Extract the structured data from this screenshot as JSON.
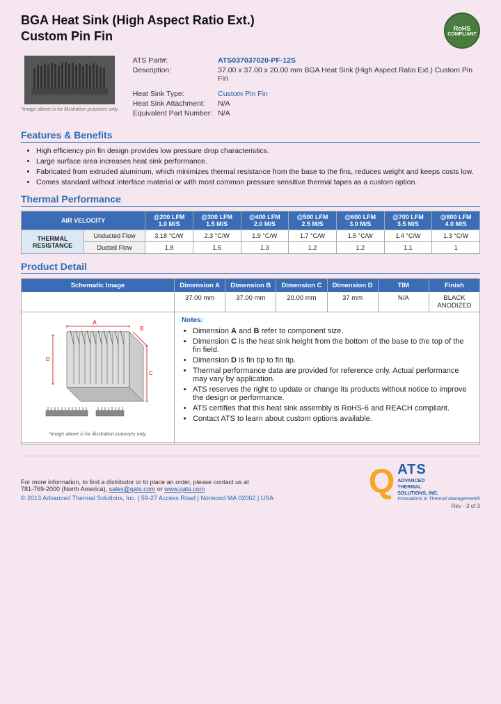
{
  "page": {
    "background": "#f5e6f0"
  },
  "header": {
    "title_line1": "BGA Heat Sink (High Aspect Ratio Ext.)",
    "title_line2": "Custom Pin Fin",
    "rohs": {
      "line1": "RoHS",
      "line2": "COMPLIANT"
    }
  },
  "product": {
    "part_label": "ATS Part#:",
    "part_number": "ATS037037020-PF-12S",
    "description_label": "Description:",
    "description_value": "37.00 x 37.00 x 20.00 mm  BGA Heat Sink (High Aspect Ratio Ext.) Custom Pin Fin",
    "heat_sink_type_label": "Heat Sink Type:",
    "heat_sink_type_value": "Custom Pin Fin",
    "attachment_label": "Heat Sink Attachment:",
    "attachment_value": "N/A",
    "equiv_part_label": "Equivalent Part Number:",
    "equiv_part_value": "N/A"
  },
  "image_caption": "*Image above is for illustration purposes only.",
  "features": {
    "title": "Features & Benefits",
    "items": [
      "High efficiency pin fin design provides low pressure drop characteristics.",
      "Large surface area increases heat sink performance.",
      "Fabricated from extruded aluminum, which minimizes thermal resistance from the base to the fins, reduces weight and keeps costs low.",
      "Comes standard without interface material or with most common pressure sensitive thermal tapes as a custom option."
    ]
  },
  "thermal": {
    "title": "Thermal Performance",
    "col_headers": [
      "AIR VELOCITY",
      "@200 LFM\n1.0 M/S",
      "@300 LFM\n1.5 M/S",
      "@400 LFM\n2.0 M/S",
      "@500 LFM\n2.5 M/S",
      "@600 LFM\n3.0 M/S",
      "@700 LFM\n3.5 M/S",
      "@800 LFM\n4.0 M/S"
    ],
    "row_group": "THERMAL RESISTANCE",
    "rows": [
      {
        "label": "Unducted Flow",
        "values": [
          "3.18 °C/W",
          "2.3 °C/W",
          "1.9 °C/W",
          "1.7 °C/W",
          "1.5 °C/W",
          "1.4 °C/W",
          "1.3 °C/W"
        ]
      },
      {
        "label": "Ducted Flow",
        "values": [
          "1.8",
          "1.5",
          "1.3",
          "1.2",
          "1.2",
          "1.1",
          "1"
        ]
      }
    ]
  },
  "product_detail": {
    "title": "Product Detail",
    "schematic_caption": "*Image above is for illustration purposes only.",
    "columns": [
      "Schematic Image",
      "Dimension A",
      "Dimension B",
      "Dimension C",
      "Dimension D",
      "TIM",
      "Finish"
    ],
    "values": [
      "37.00 mm",
      "37.00 mm",
      "20.00 mm",
      "37 mm",
      "N/A",
      "BLACK ANODIZED"
    ],
    "notes_title": "Notes:",
    "notes": [
      {
        "text": "Dimension A and B refer to component size.",
        "bold_parts": []
      },
      {
        "text": "Dimension C is the heat sink height from the bottom of the base to the top of the fin field.",
        "bold_parts": [
          "C"
        ]
      },
      {
        "text": "Dimension D is fin tip to fin tip.",
        "bold_parts": [
          "D"
        ]
      },
      {
        "text": "Thermal performance data are provided for reference only. Actual performance may vary by application.",
        "bold_parts": []
      },
      {
        "text": "ATS reserves the right to update or change its products without notice to improve the design or performance.",
        "bold_parts": []
      },
      {
        "text": "ATS certifies that this heat sink assembly is RoHS-6 and REACH compliant.",
        "bold_parts": []
      },
      {
        "text": "Contact ATS to learn about custom options available.",
        "bold_parts": []
      }
    ]
  },
  "footer": {
    "contact_text": "For more information, to find a distributor or to place an order, please contact us at",
    "phone": "781-769-2000 (North America),",
    "email": "sales@qats.com",
    "or": "or",
    "website": "www.qats.com",
    "copyright": "© 2013 Advanced Thermal Solutions, Inc.  |  59-27 Access Road  |  Norwood MA   02062  |  USA",
    "ats_q": "Q",
    "ats_name": "ATS",
    "ats_full": "ADVANCED\nTHERMAL\nSOLUTIONS, INC.",
    "ats_tagline": "Innovations in Thermal Management®",
    "page_info": "Rev - 3 of 3"
  }
}
